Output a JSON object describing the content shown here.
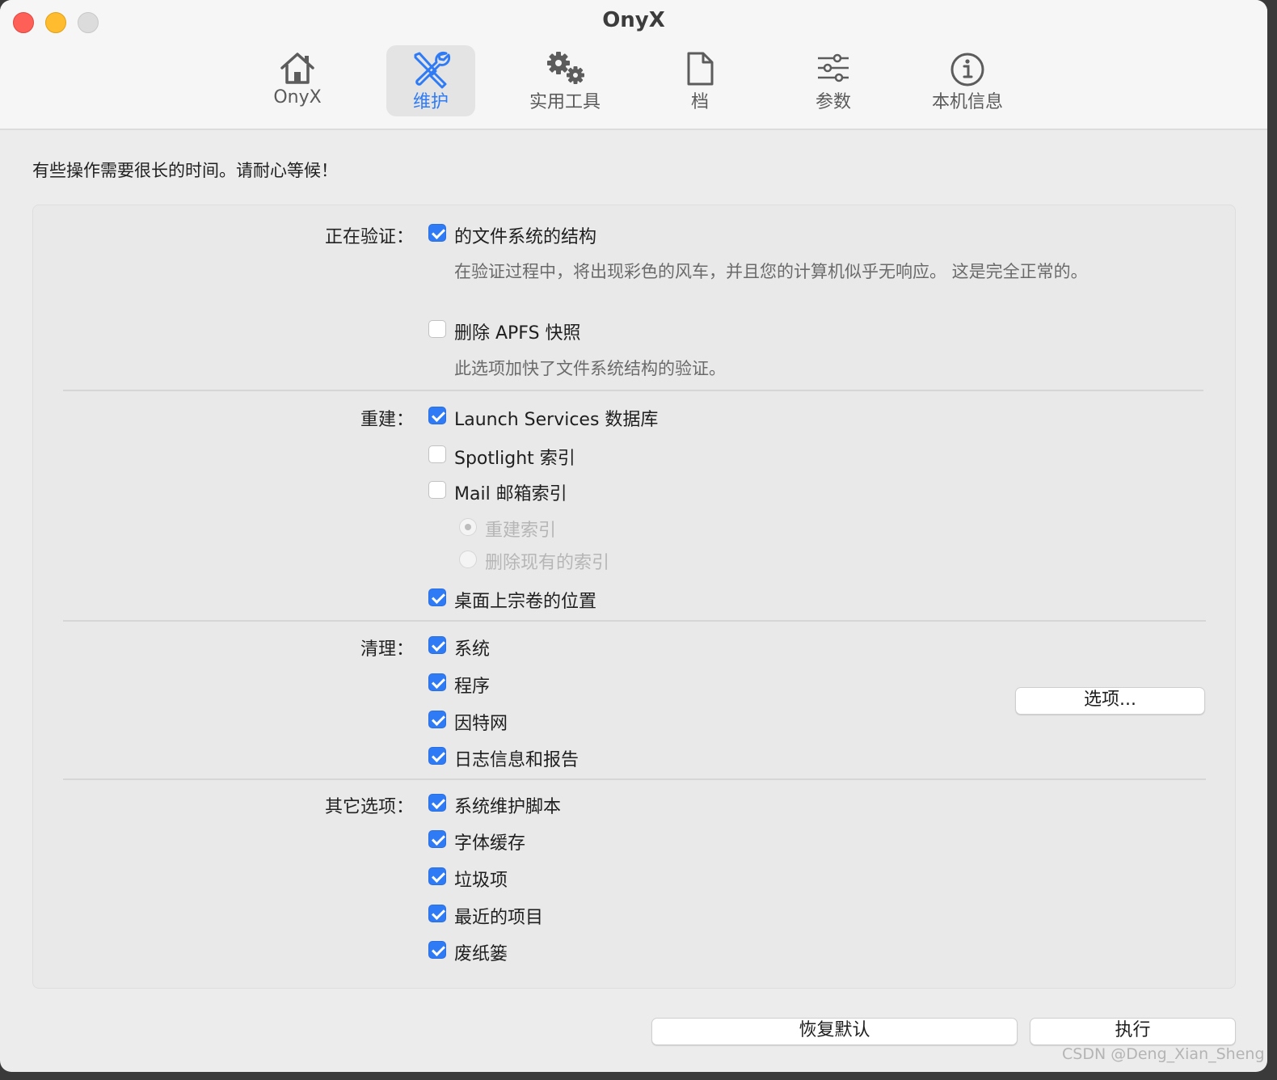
{
  "window": {
    "title": "OnyX"
  },
  "tabs": [
    {
      "label": "OnyX",
      "icon": "house-icon"
    },
    {
      "label": "维护",
      "icon": "wrench-screwdriver-icon",
      "active": true
    },
    {
      "label": "实用工具",
      "icon": "gears-icon"
    },
    {
      "label": "档",
      "icon": "document-icon"
    },
    {
      "label": "参数",
      "icon": "sliders-icon"
    },
    {
      "label": "本机信息",
      "icon": "info-icon"
    }
  ],
  "notice": "有些操作需要很长的时间。请耐心等候！",
  "verify": {
    "label": "正在验证：",
    "fs_structure": {
      "label": "的文件系统的结构",
      "checked": true
    },
    "fs_desc": "在验证过程中，将出现彩色的风车，并且您的计算机似乎无响应。 这是完全正常的。",
    "apfs": {
      "label": "删除 APFS 快照",
      "checked": false
    },
    "apfs_desc": "此选项加快了文件系统结构的验证。"
  },
  "rebuild": {
    "label": "重建：",
    "launch_services": {
      "label": "Launch Services 数据库",
      "checked": true
    },
    "spotlight": {
      "label": "Spotlight 索引",
      "checked": false
    },
    "mail": {
      "label": "Mail 邮箱索引",
      "checked": false
    },
    "mail_options": [
      {
        "label": "重建索引",
        "selected": true,
        "disabled": true
      },
      {
        "label": "删除现有的索引",
        "selected": false,
        "disabled": true
      }
    ],
    "desktop": {
      "label": "桌面上宗卷的位置",
      "checked": true
    }
  },
  "cleanup": {
    "label": "清理：",
    "items": [
      {
        "label": "系统",
        "checked": true
      },
      {
        "label": "程序",
        "checked": true
      },
      {
        "label": "因特网",
        "checked": true
      },
      {
        "label": "日志信息和报告",
        "checked": true
      }
    ],
    "options_button": "选项..."
  },
  "other": {
    "label": "其它选项：",
    "items": [
      {
        "label": "系统维护脚本",
        "checked": true
      },
      {
        "label": "字体缓存",
        "checked": true
      },
      {
        "label": "垃圾项",
        "checked": true
      },
      {
        "label": "最近的项目",
        "checked": true
      },
      {
        "label": "废纸篓",
        "checked": true
      }
    ]
  },
  "footer": {
    "restore_defaults": "恢复默认",
    "execute": "执行"
  },
  "watermark": "CSDN @Deng_Xian_Sheng",
  "colors": {
    "accent": "#2f7bf6",
    "background": "#ececec",
    "panel": "#e9e9e9"
  }
}
